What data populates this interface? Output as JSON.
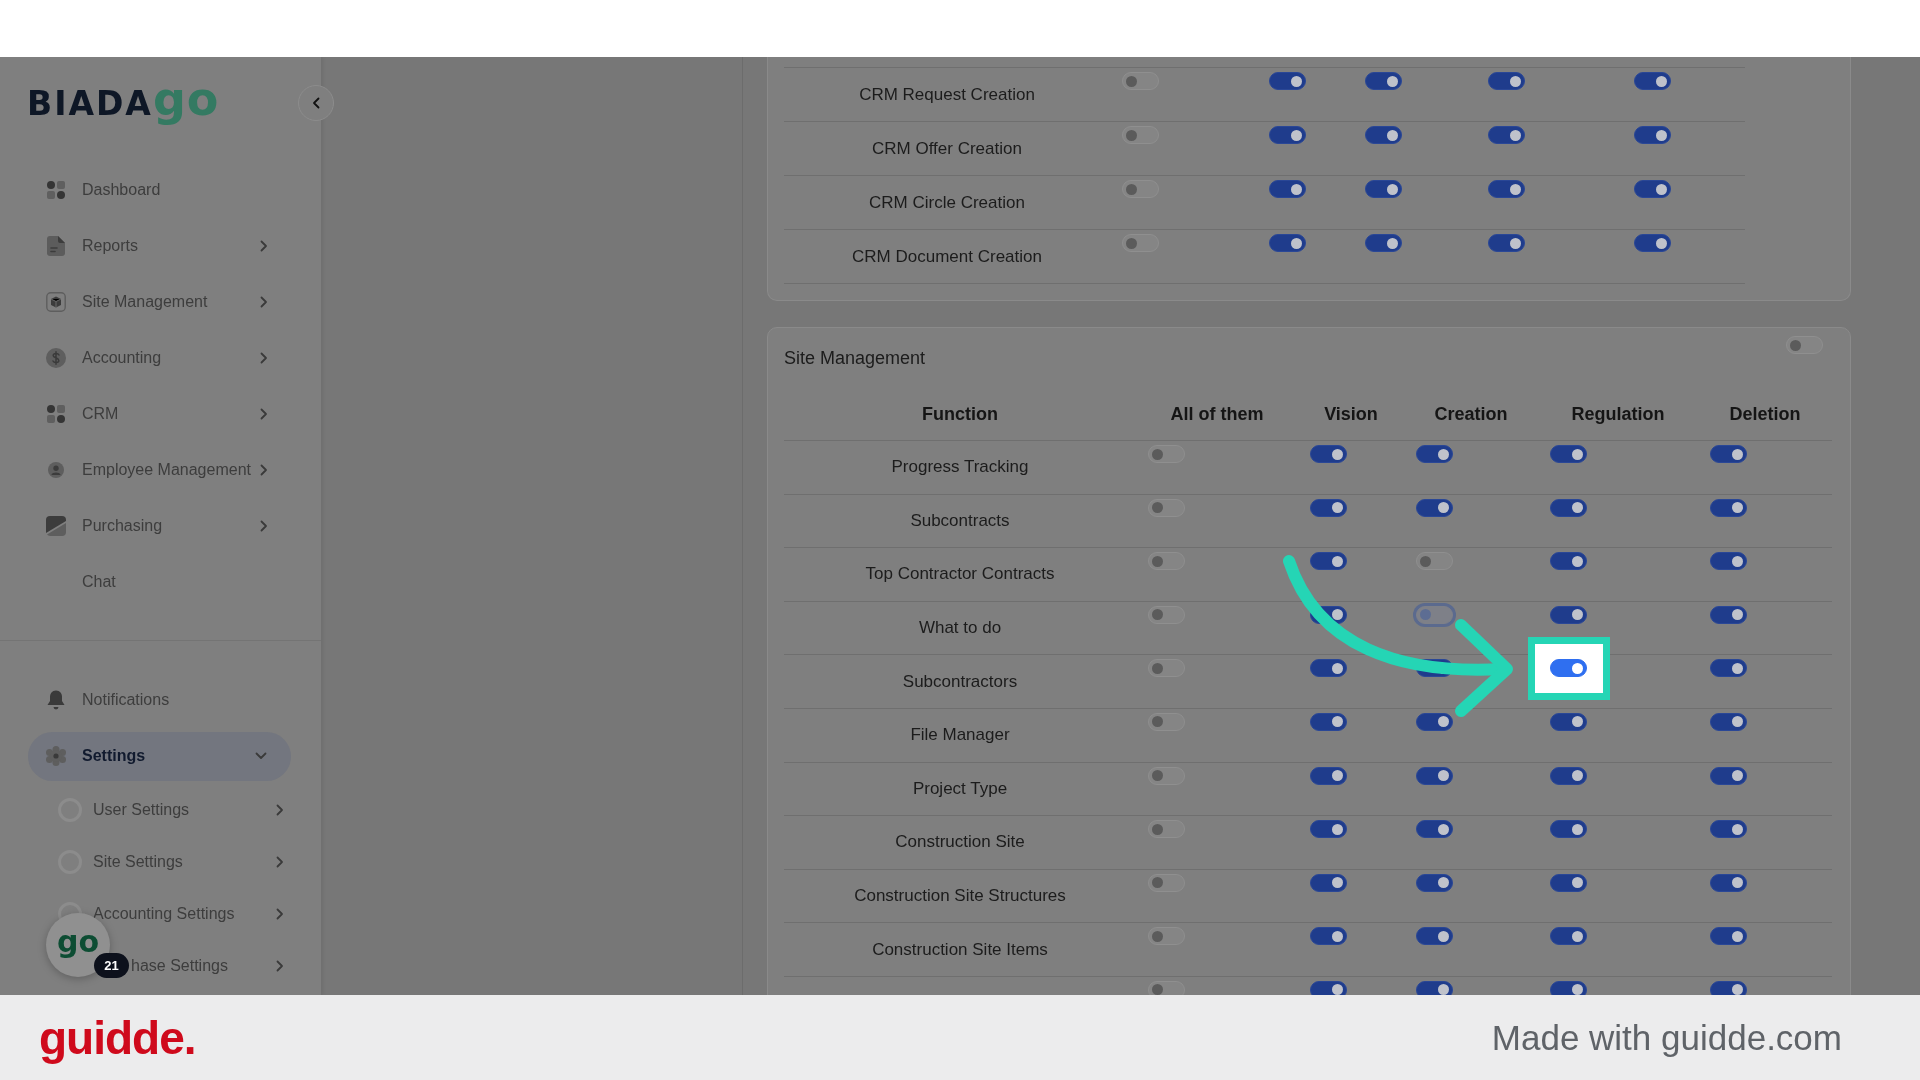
{
  "sidebar": {
    "logo": {
      "text": "BIADA",
      "accent": "go"
    },
    "items": [
      {
        "label": "Dashboard",
        "selected": false,
        "submenu": false
      },
      {
        "label": "Reports",
        "selected": false,
        "submenu": true,
        "expanded": false
      },
      {
        "label": "Site Management",
        "selected": false,
        "submenu": true,
        "expanded": false
      },
      {
        "label": "Accounting",
        "selected": false,
        "submenu": true,
        "expanded": false
      },
      {
        "label": "CRM",
        "selected": false,
        "submenu": true,
        "expanded": false
      },
      {
        "label": "Employee Management",
        "selected": false,
        "submenu": true,
        "expanded": false
      },
      {
        "label": "Purchasing",
        "selected": false,
        "submenu": true,
        "expanded": false
      },
      {
        "label": "Chat",
        "selected": false,
        "submenu": false
      }
    ],
    "bottom_items": [
      {
        "label": "Notifications",
        "selected": false,
        "submenu": false
      },
      {
        "label": "Settings",
        "selected": true,
        "submenu": true,
        "expanded": true,
        "children": [
          {
            "label": "User Settings",
            "selected": false,
            "submenu": true,
            "covered": false
          },
          {
            "label": "Site Settings",
            "selected": false,
            "submenu": true,
            "covered": false
          },
          {
            "label": "Accounting Settings",
            "selected": false,
            "submenu": true,
            "covered": false
          },
          {
            "label": "hase Settings",
            "selected": false,
            "submenu": true,
            "covered": true
          }
        ]
      }
    ]
  },
  "chat_button": {
    "label": "go",
    "badge": "21"
  },
  "crm_card": {
    "rows": [
      {
        "function": "CRM Request Creation",
        "toggles": [
          {
            "on": false
          },
          {
            "on": true
          },
          {
            "on": true
          },
          {
            "on": true
          },
          {
            "on": true
          }
        ]
      },
      {
        "function": "CRM Offer Creation",
        "toggles": [
          {
            "on": false
          },
          {
            "on": true
          },
          {
            "on": true
          },
          {
            "on": true
          },
          {
            "on": true
          }
        ]
      },
      {
        "function": "CRM Circle Creation",
        "toggles": [
          {
            "on": false
          },
          {
            "on": true
          },
          {
            "on": true
          },
          {
            "on": true
          },
          {
            "on": true
          }
        ]
      },
      {
        "function": "CRM Document Creation",
        "toggles": [
          {
            "on": false
          },
          {
            "on": true
          },
          {
            "on": true
          },
          {
            "on": true
          },
          {
            "on": true
          }
        ]
      }
    ]
  },
  "site_management": {
    "title": "Site Management",
    "section_toggle": {
      "on": false
    },
    "columns": [
      "Function",
      "All of them",
      "Vision",
      "Creation",
      "Regulation",
      "Deletion"
    ],
    "rows": [
      {
        "function": "Progress Tracking",
        "toggles": [
          {
            "on": false
          },
          {
            "on": true
          },
          {
            "on": true
          },
          {
            "on": true
          },
          {
            "on": true
          }
        ]
      },
      {
        "function": "Subcontracts",
        "toggles": [
          {
            "on": false
          },
          {
            "on": true
          },
          {
            "on": true
          },
          {
            "on": true
          },
          {
            "on": true
          }
        ]
      },
      {
        "function": "Top Contractor Contracts",
        "toggles": [
          {
            "on": false
          },
          {
            "on": true
          },
          {
            "on": false
          },
          {
            "on": true
          },
          {
            "on": true
          }
        ]
      },
      {
        "function": "What to do",
        "toggles": [
          {
            "on": false
          },
          {
            "on": true
          },
          {
            "on": false,
            "focused": true
          },
          {
            "on": true
          },
          {
            "on": true
          }
        ]
      },
      {
        "function": "Subcontractors",
        "toggles": [
          {
            "on": false
          },
          {
            "on": true
          },
          {
            "on": true
          },
          {
            "on": true,
            "highlighted": true
          },
          {
            "on": true
          }
        ]
      },
      {
        "function": "File Manager",
        "toggles": [
          {
            "on": false
          },
          {
            "on": true
          },
          {
            "on": true
          },
          {
            "on": true
          },
          {
            "on": true
          }
        ]
      },
      {
        "function": "Project Type",
        "toggles": [
          {
            "on": false
          },
          {
            "on": true
          },
          {
            "on": true
          },
          {
            "on": true
          },
          {
            "on": true
          }
        ]
      },
      {
        "function": "Construction Site",
        "toggles": [
          {
            "on": false
          },
          {
            "on": true
          },
          {
            "on": true
          },
          {
            "on": true
          },
          {
            "on": true
          }
        ]
      },
      {
        "function": "Construction Site Structures",
        "toggles": [
          {
            "on": false
          },
          {
            "on": true
          },
          {
            "on": true
          },
          {
            "on": true
          },
          {
            "on": true
          }
        ]
      },
      {
        "function": "Construction Site Items",
        "toggles": [
          {
            "on": false
          },
          {
            "on": true
          },
          {
            "on": true
          },
          {
            "on": true
          },
          {
            "on": true
          }
        ]
      },
      {
        "toggles": [
          {
            "on": false
          },
          {
            "on": true
          },
          {
            "on": true
          },
          {
            "on": true
          },
          {
            "on": true
          }
        ]
      }
    ]
  },
  "footer": {
    "logo": "guidde.",
    "credit": "Made with guidde.com"
  }
}
